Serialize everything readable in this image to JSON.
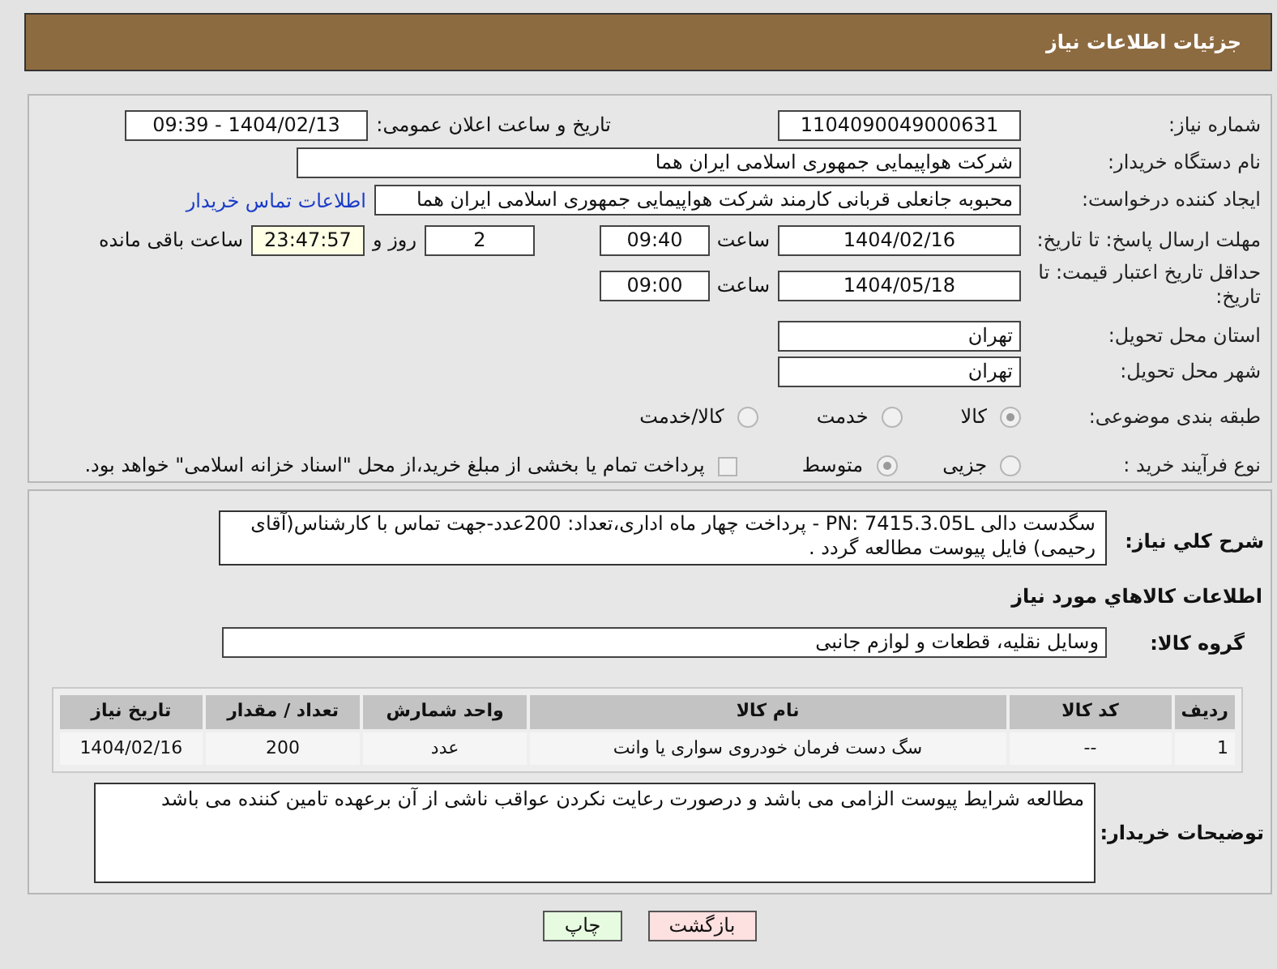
{
  "header": {
    "title": "جزئیات اطلاعات نیاز"
  },
  "need_number": {
    "label": "شماره نیاز:",
    "value": "1104090049000631"
  },
  "announce": {
    "label": "تاریخ و ساعت اعلان عمومی:",
    "value": "1404/02/13 - 09:39"
  },
  "buyer_org": {
    "label": "نام دستگاه خریدار:",
    "value": "شرکت هواپیمایی جمهوری اسلامی ایران هما"
  },
  "requester": {
    "label": "ایجاد کننده درخواست:",
    "value": "محبوبه جانعلی قربانی کارمند شرکت هواپیمایی جمهوری اسلامی ایران هما",
    "link": "اطلاعات تماس خریدار"
  },
  "deadline": {
    "label": "مهلت ارسال پاسخ: تا تاریخ:",
    "date": "1404/02/16",
    "time_label": "ساعت",
    "time": "09:40",
    "days": "2",
    "days_label": "روز و",
    "remaining": "23:47:57",
    "remaining_label": "ساعت باقی مانده"
  },
  "price_validity": {
    "label": "حداقل تاریخ اعتبار قیمت: تا تاریخ:",
    "date": "1404/05/18",
    "time_label": "ساعت",
    "time": "09:00"
  },
  "province": {
    "label": "استان محل تحویل:",
    "value": "تهران"
  },
  "city": {
    "label": "شهر محل تحویل:",
    "value": "تهران"
  },
  "category": {
    "label": "طبقه بندی موضوعی:",
    "options": [
      {
        "label": "کالا",
        "selected": true
      },
      {
        "label": "خدمت",
        "selected": false
      },
      {
        "label": "کالا/خدمت",
        "selected": false
      }
    ]
  },
  "process": {
    "label": "نوع فرآیند خرید :",
    "options": [
      {
        "label": "جزیی",
        "selected": false
      },
      {
        "label": "متوسط",
        "selected": true
      }
    ],
    "payment": {
      "label": "پرداخت تمام یا بخشی از مبلغ خرید،از محل \"اسناد خزانه اسلامی\" خواهد بود.",
      "checked": false
    }
  },
  "description": {
    "label": "شرح کلي نياز:",
    "value": "سگدست دالی PN: 7415.3.05L - پرداخت چهار ماه اداری،تعداد: 200عدد-جهت تماس با کارشناس(آقای رحیمی) فایل پیوست مطالعه گردد ."
  },
  "goods_title": "اطلاعات کالاهاي مورد نياز",
  "goods_group": {
    "label": "گروه کالا:",
    "value": "وسایل نقلیه، قطعات و لوازم جانبی"
  },
  "table": {
    "columns": [
      "ردیف",
      "کد کالا",
      "نام کالا",
      "واحد شمارش",
      "تعداد / مقدار",
      "تاریخ نیاز"
    ],
    "rows": [
      [
        "1",
        "--",
        "سگ دست فرمان خودروی سواری یا وانت",
        "عدد",
        "200",
        "1404/02/16"
      ]
    ]
  },
  "buyer_notes": {
    "label": "توضیحات خریدار:",
    "value": "مطالعه شرایط پیوست الزامی می باشد و درصورت رعایت نکردن عواقب ناشی از آن برعهده تامین کننده می باشد"
  },
  "buttons": [
    {
      "label": "بازگشت",
      "kind": "back"
    },
    {
      "label": "چاپ",
      "kind": "print"
    }
  ]
}
